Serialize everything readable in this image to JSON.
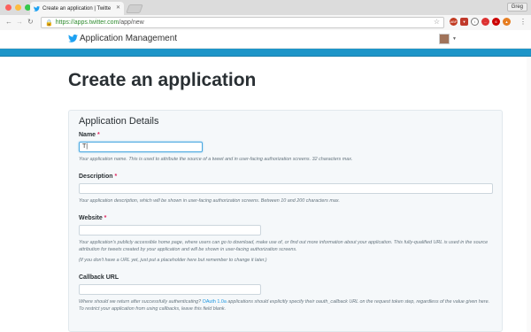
{
  "browser": {
    "tab_title": "Create an application | Twitte",
    "user_label": "Greg",
    "url_host": "https://apps.twitter.com",
    "url_path": "/app/new"
  },
  "app_header": {
    "brand_text": "Application Management"
  },
  "page": {
    "title": "Create an application"
  },
  "form": {
    "section_title": "Application Details",
    "required_mark": "*",
    "fields": {
      "name": {
        "label": "Name",
        "value": "T|",
        "help": "Your application name. This is used to attribute the source of a tweet and in user-facing authorization screens. 32 characters max."
      },
      "description": {
        "label": "Description",
        "value": "",
        "help": "Your application description, which will be shown in user-facing authorization screens. Between 10 and 200 characters max."
      },
      "website": {
        "label": "Website",
        "value": "",
        "help1": "Your application's publicly accessible home page, where users can go to download, make use of, or find out more information about your application. This fully-qualified URL is used in the source attribution for tweets created by your application and will be shown in user-facing authorization screens.",
        "help2": "(If you don't have a URL yet, just put a placeholder here but remember to change it later.)"
      },
      "callback": {
        "label": "Callback URL",
        "value": "",
        "help_pre": "Where should we return after successfully authenticating?",
        "help_link": "OAuth 1.0a",
        "help_post": "applications should explicitly specify their oauth_callback URL on the request token step, regardless of the value given here. To restrict your application from using callbacks, leave this field blank."
      }
    }
  },
  "colors": {
    "accent_blue": "#1e95c8",
    "twitter_blue": "#1da1f2",
    "required_red": "#e0245e"
  }
}
